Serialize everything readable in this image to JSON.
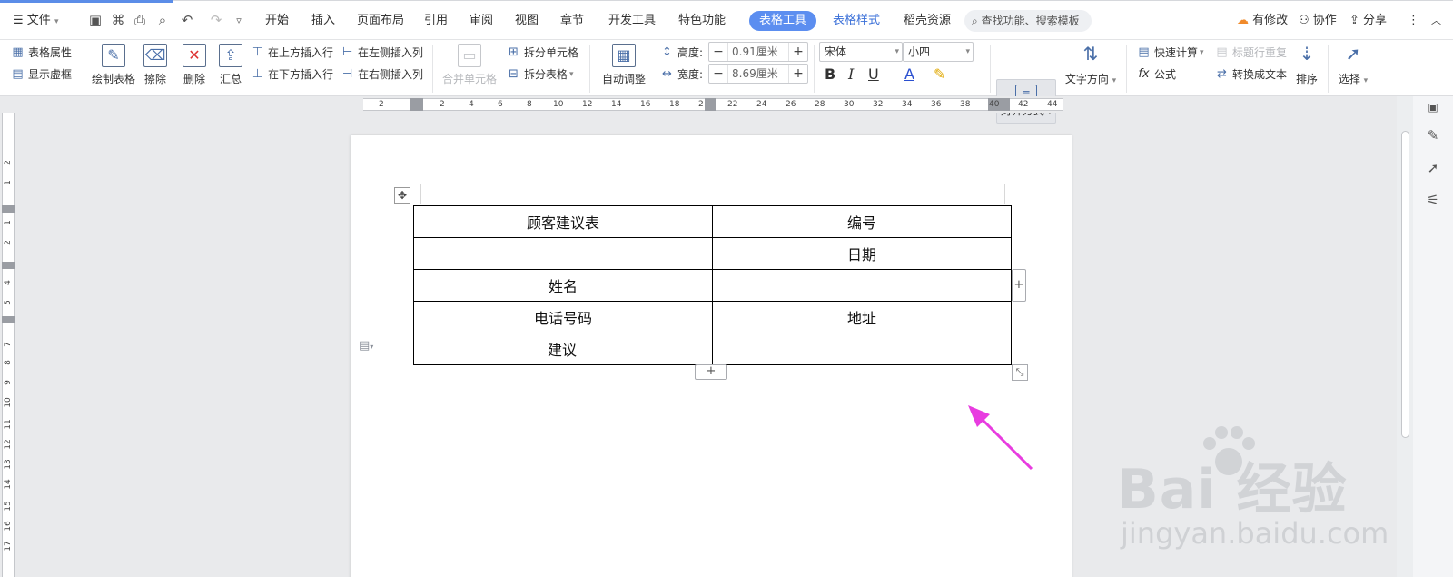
{
  "menubar": {
    "file_label": "文件",
    "tabs": [
      "开始",
      "插入",
      "页面布局",
      "引用",
      "审阅",
      "视图",
      "章节",
      "开发工具",
      "特色功能"
    ],
    "active_tab": "表格工具",
    "tab_table_style": "表格样式",
    "tab_daoke": "稻壳资源",
    "search_placeholder": "查找功能、搜索模板",
    "has_changes": "有修改",
    "collaborate": "协作",
    "share": "分享"
  },
  "ribbon": {
    "table_props": "表格属性",
    "show_grid": "显示虚框",
    "draw_table": "绘制表格",
    "erase": "擦除",
    "delete": "删除",
    "summary": "汇总",
    "insert_above": "在上方插入行",
    "insert_below": "在下方插入行",
    "insert_left": "在左侧插入列",
    "insert_right": "在右侧插入列",
    "merge_cells": "合并单元格",
    "split_cells": "拆分单元格",
    "split_table": "拆分表格",
    "auto_adjust": "自动调整",
    "height_label": "高度:",
    "height_value": "0.91厘米",
    "width_label": "宽度:",
    "width_value": "8.69厘米",
    "font_name": "宋体",
    "font_size": "小四",
    "align": "对齐方式",
    "text_dir": "文字方向",
    "quick_calc": "快速计算",
    "formula": "公式",
    "repeat_title": "标题行重复",
    "to_text": "转换成文本",
    "sort": "排序",
    "select": "选择"
  },
  "ruler": {
    "h_ticks": [
      "2",
      "2",
      "4",
      "6",
      "8",
      "10",
      "12",
      "14",
      "16",
      "18",
      "2",
      "22",
      "24",
      "26",
      "28",
      "30",
      "32",
      "34",
      "36",
      "38",
      "40",
      "42",
      "44"
    ],
    "v_ticks": [
      "2",
      "1",
      "1",
      "2",
      "4",
      "5",
      "7",
      "8",
      "9",
      "10",
      "11",
      "12",
      "13",
      "14",
      "15",
      "16",
      "17"
    ]
  },
  "table": {
    "rows": [
      [
        "顾客建议表",
        "编号"
      ],
      [
        "",
        "日期"
      ],
      [
        "姓名",
        ""
      ],
      [
        "电话号码",
        "地址"
      ],
      [
        "建议",
        ""
      ]
    ]
  },
  "watermark": {
    "brand": "Bai  经验",
    "url": "jingyan.baidu.com"
  },
  "colors": {
    "accent": "#5c8ef0",
    "arrow": "#e83ce0"
  }
}
